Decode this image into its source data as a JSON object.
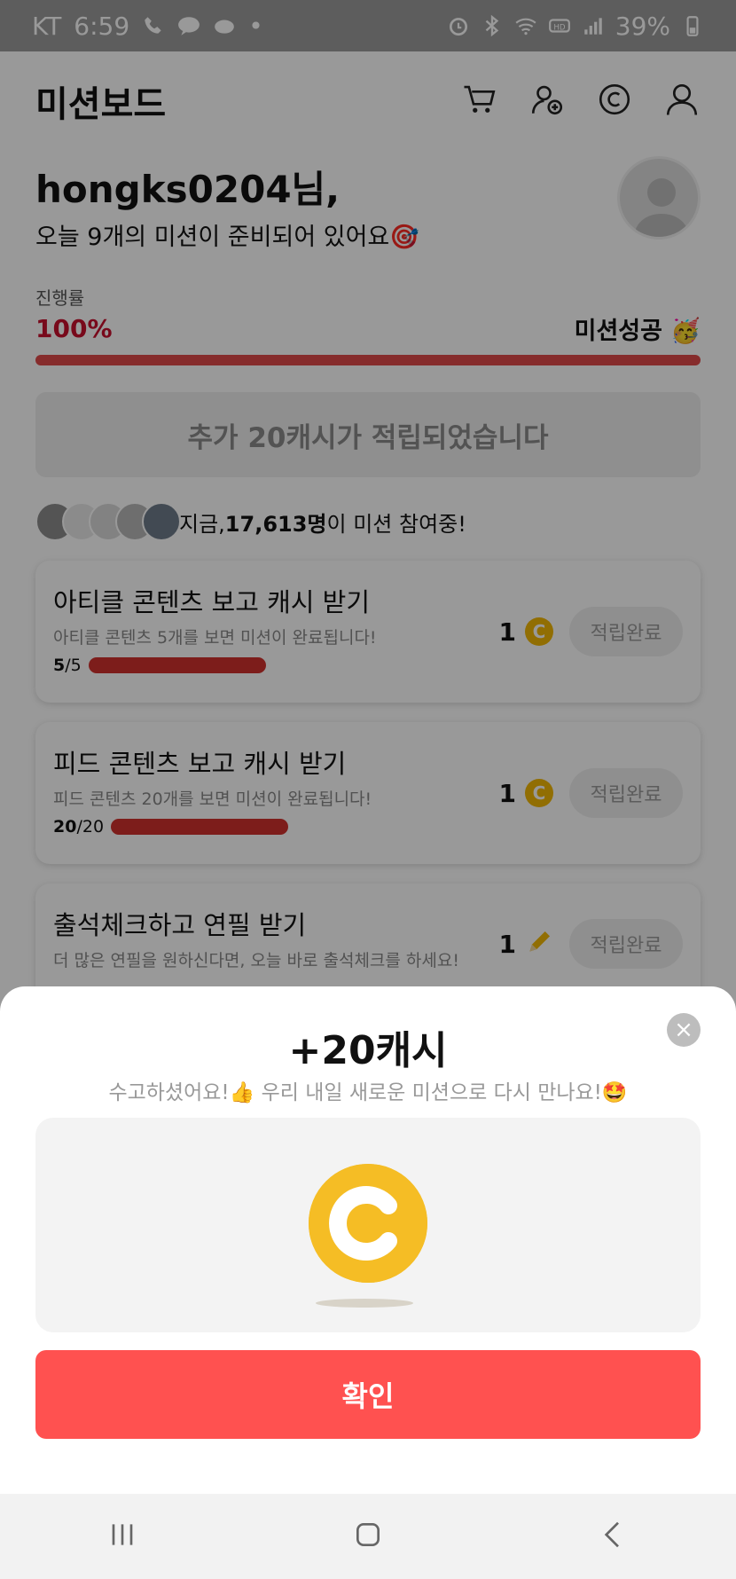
{
  "status_bar": {
    "carrier": "KT",
    "time": "6:59",
    "battery": "39%",
    "icons": [
      "phone-icon",
      "talk-icon",
      "cloud-icon",
      "dot-icon",
      "alarm-icon",
      "bluetooth-icon",
      "wifi-icon",
      "hd-icon",
      "signal-icon",
      "battery-icon"
    ]
  },
  "header": {
    "title": "미션보드",
    "actions": [
      "cart-icon",
      "add-friend-icon",
      "cash-icon",
      "profile-icon"
    ]
  },
  "greeting": {
    "user": "hongks0204님,",
    "subtitle": "오늘 9개의 미션이 준비되어 있어요🎯"
  },
  "progress": {
    "label": "진행률",
    "percent_text": "100%",
    "status": "미션성공 🥳",
    "fraction": 1.0
  },
  "banner": {
    "text": "추가 20캐시가 적립되었습니다"
  },
  "participants": {
    "prefix": "지금, ",
    "count": "17,613명",
    "suffix": "이 미션 참여중!"
  },
  "missions": [
    {
      "title": "아티클 콘텐츠 보고 캐시 받기",
      "desc": "아티클 콘텐츠 5개를 보면 미션이 완료됩니다!",
      "done": "5",
      "total": "/5",
      "reward": "1",
      "button": "적립완료"
    },
    {
      "title": "피드 콘텐츠 보고 캐시 받기",
      "desc": "피드 콘텐츠 20개를 보면 미션이 완료됩니다!",
      "done": "20",
      "total": "/20",
      "reward": "1",
      "button": "적립완료"
    },
    {
      "title": "출석체크하고 연필 받기",
      "desc": "더 많은 연필을 원하신다면, 오늘 바로 출석체크를 하세요!",
      "reward": "1",
      "button": "적립완료"
    }
  ],
  "sheet": {
    "title": "+20캐시",
    "subtitle": "수고하셨어요!👍 우리 내일 새로운 미션으로 다시 만나요!🤩",
    "confirm": "확인",
    "close": "×"
  },
  "colors": {
    "accent_red": "#ff5150",
    "progress_red": "#c8102e",
    "coin_yellow": "#f5bd25"
  }
}
